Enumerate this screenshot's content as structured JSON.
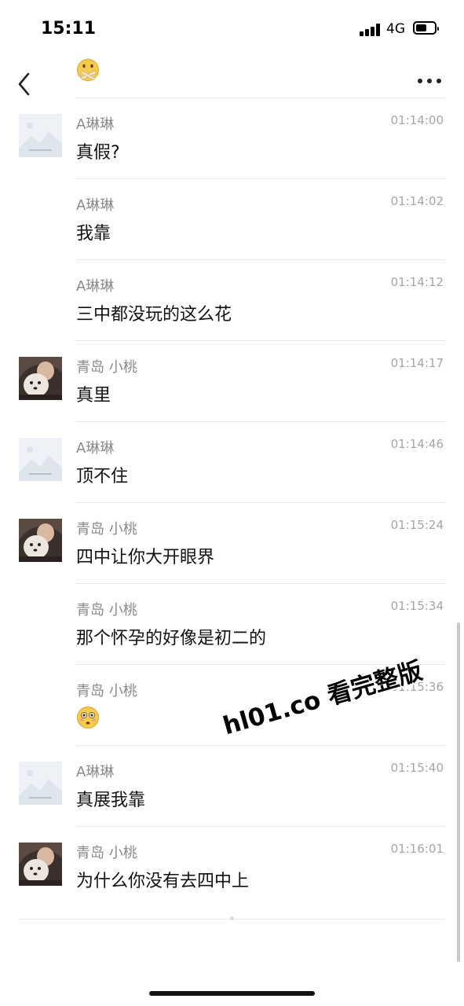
{
  "status_bar": {
    "time": "15:11",
    "network": "4G",
    "battery": 0.45
  },
  "nav": {
    "title_icon": "tape-mouth-emoji-icon",
    "back_icon": "chevron-left-icon",
    "more_icon": "more-dots-icon"
  },
  "messages": [
    {
      "sender": "A琳琳",
      "time": "01:14:00",
      "text": "真假?",
      "avatar": "placeholder-image"
    },
    {
      "sender": "A琳琳",
      "time": "01:14:02",
      "text": "我靠",
      "avatar": ""
    },
    {
      "sender": "A琳琳",
      "time": "01:14:12",
      "text": "三中都没玩的这么花",
      "avatar": ""
    },
    {
      "sender": "青岛 小桃",
      "time": "01:14:17",
      "text": "真里",
      "avatar": "photo-avatar"
    },
    {
      "sender": "A琳琳",
      "time": "01:14:46",
      "text": "顶不住",
      "avatar": "placeholder-image"
    },
    {
      "sender": "青岛 小桃",
      "time": "01:15:24",
      "text": "四中让你大开眼界",
      "avatar": "photo-avatar"
    },
    {
      "sender": "青岛 小桃",
      "time": "01:15:34",
      "text": "那个怀孕的好像是初二的",
      "avatar": ""
    },
    {
      "sender": "青岛 小桃",
      "time": "01:15:36",
      "text": "",
      "emoji": "flushed-face-emoji-icon",
      "avatar": ""
    },
    {
      "sender": "A琳琳",
      "time": "01:15:40",
      "text": "真展我靠",
      "avatar": "placeholder-image"
    },
    {
      "sender": "青岛 小桃",
      "time": "01:16:01",
      "text": "为什么你没有去四中上",
      "avatar": "photo-avatar"
    }
  ],
  "watermark": "hl01.co 看完整版",
  "colors": {
    "separator": "#e6e6e6",
    "sender_text": "#8a8a8a",
    "time_text": "#a5a5a5",
    "message_text": "#111111"
  }
}
